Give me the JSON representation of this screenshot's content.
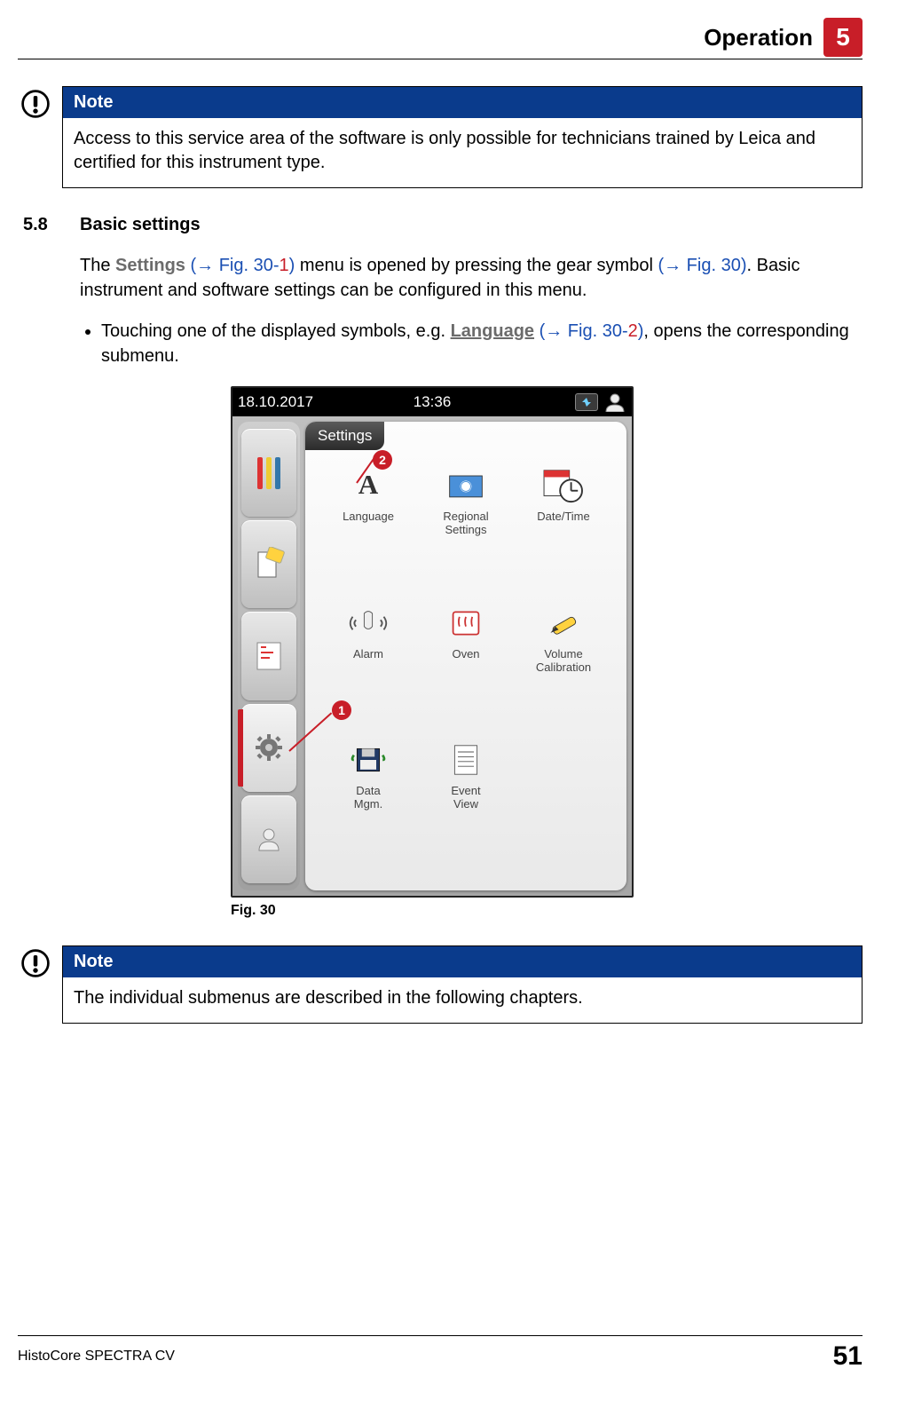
{
  "header": {
    "title": "Operation",
    "chapter": "5"
  },
  "note1": {
    "label": "Note",
    "body": "Access to this service area of the software is only possible for technicians trained by Leica and certified for this instrument type."
  },
  "section": {
    "num": "5.8",
    "title": "Basic settings"
  },
  "para1": {
    "a": "The ",
    "settings": "Settings",
    "b": " ",
    "ref1a": "(→ Fig.  30-",
    "ref1b": "1",
    "ref1c": ")",
    "c": " menu is opened by pressing the gear symbol ",
    "ref2": "(→ Fig.  30)",
    "d": ". Basic instrument and software settings can be configured in this menu."
  },
  "bullet1": {
    "a": "Touching one of the displayed symbols, e.g. ",
    "lang": "Language",
    "b": " ",
    "ref1a": "(→ Fig.  30-",
    "ref1b": "2",
    "ref1c": ")",
    "c": ", opens the corresponding submenu."
  },
  "device": {
    "date": "18.10.2017",
    "time": "13:36",
    "panel_title": "Settings",
    "tiles": {
      "language": "Language",
      "regional": "Regional\nSettings",
      "datetime": "Date/Time",
      "alarm": "Alarm",
      "oven": "Oven",
      "volcal": "Volume\nCalibration",
      "datamgm": "Data\nMgm.",
      "eventview": "Event\nView"
    },
    "callouts": {
      "c1": "1",
      "c2": "2"
    }
  },
  "fig_caption": "Fig.  30",
  "note2": {
    "label": "Note",
    "body": "The individual submenus are described in the following chapters."
  },
  "footer": {
    "product": "HistoCore SPECTRA CV",
    "page": "51"
  }
}
